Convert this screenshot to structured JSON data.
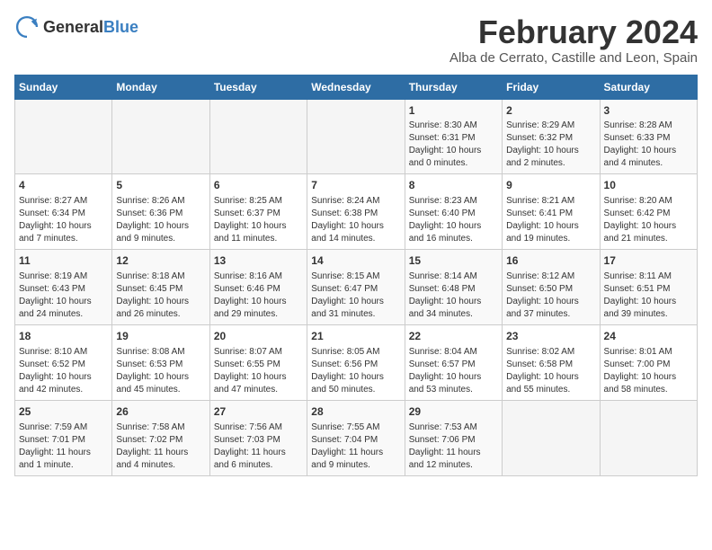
{
  "logo": {
    "general": "General",
    "blue": "Blue"
  },
  "title": "February 2024",
  "subtitle": "Alba de Cerrato, Castille and Leon, Spain",
  "days_of_week": [
    "Sunday",
    "Monday",
    "Tuesday",
    "Wednesday",
    "Thursday",
    "Friday",
    "Saturday"
  ],
  "weeks": [
    [
      {
        "day": "",
        "info": ""
      },
      {
        "day": "",
        "info": ""
      },
      {
        "day": "",
        "info": ""
      },
      {
        "day": "",
        "info": ""
      },
      {
        "day": "1",
        "info": "Sunrise: 8:30 AM\nSunset: 6:31 PM\nDaylight: 10 hours\nand 0 minutes."
      },
      {
        "day": "2",
        "info": "Sunrise: 8:29 AM\nSunset: 6:32 PM\nDaylight: 10 hours\nand 2 minutes."
      },
      {
        "day": "3",
        "info": "Sunrise: 8:28 AM\nSunset: 6:33 PM\nDaylight: 10 hours\nand 4 minutes."
      }
    ],
    [
      {
        "day": "4",
        "info": "Sunrise: 8:27 AM\nSunset: 6:34 PM\nDaylight: 10 hours\nand 7 minutes."
      },
      {
        "day": "5",
        "info": "Sunrise: 8:26 AM\nSunset: 6:36 PM\nDaylight: 10 hours\nand 9 minutes."
      },
      {
        "day": "6",
        "info": "Sunrise: 8:25 AM\nSunset: 6:37 PM\nDaylight: 10 hours\nand 11 minutes."
      },
      {
        "day": "7",
        "info": "Sunrise: 8:24 AM\nSunset: 6:38 PM\nDaylight: 10 hours\nand 14 minutes."
      },
      {
        "day": "8",
        "info": "Sunrise: 8:23 AM\nSunset: 6:40 PM\nDaylight: 10 hours\nand 16 minutes."
      },
      {
        "day": "9",
        "info": "Sunrise: 8:21 AM\nSunset: 6:41 PM\nDaylight: 10 hours\nand 19 minutes."
      },
      {
        "day": "10",
        "info": "Sunrise: 8:20 AM\nSunset: 6:42 PM\nDaylight: 10 hours\nand 21 minutes."
      }
    ],
    [
      {
        "day": "11",
        "info": "Sunrise: 8:19 AM\nSunset: 6:43 PM\nDaylight: 10 hours\nand 24 minutes."
      },
      {
        "day": "12",
        "info": "Sunrise: 8:18 AM\nSunset: 6:45 PM\nDaylight: 10 hours\nand 26 minutes."
      },
      {
        "day": "13",
        "info": "Sunrise: 8:16 AM\nSunset: 6:46 PM\nDaylight: 10 hours\nand 29 minutes."
      },
      {
        "day": "14",
        "info": "Sunrise: 8:15 AM\nSunset: 6:47 PM\nDaylight: 10 hours\nand 31 minutes."
      },
      {
        "day": "15",
        "info": "Sunrise: 8:14 AM\nSunset: 6:48 PM\nDaylight: 10 hours\nand 34 minutes."
      },
      {
        "day": "16",
        "info": "Sunrise: 8:12 AM\nSunset: 6:50 PM\nDaylight: 10 hours\nand 37 minutes."
      },
      {
        "day": "17",
        "info": "Sunrise: 8:11 AM\nSunset: 6:51 PM\nDaylight: 10 hours\nand 39 minutes."
      }
    ],
    [
      {
        "day": "18",
        "info": "Sunrise: 8:10 AM\nSunset: 6:52 PM\nDaylight: 10 hours\nand 42 minutes."
      },
      {
        "day": "19",
        "info": "Sunrise: 8:08 AM\nSunset: 6:53 PM\nDaylight: 10 hours\nand 45 minutes."
      },
      {
        "day": "20",
        "info": "Sunrise: 8:07 AM\nSunset: 6:55 PM\nDaylight: 10 hours\nand 47 minutes."
      },
      {
        "day": "21",
        "info": "Sunrise: 8:05 AM\nSunset: 6:56 PM\nDaylight: 10 hours\nand 50 minutes."
      },
      {
        "day": "22",
        "info": "Sunrise: 8:04 AM\nSunset: 6:57 PM\nDaylight: 10 hours\nand 53 minutes."
      },
      {
        "day": "23",
        "info": "Sunrise: 8:02 AM\nSunset: 6:58 PM\nDaylight: 10 hours\nand 55 minutes."
      },
      {
        "day": "24",
        "info": "Sunrise: 8:01 AM\nSunset: 7:00 PM\nDaylight: 10 hours\nand 58 minutes."
      }
    ],
    [
      {
        "day": "25",
        "info": "Sunrise: 7:59 AM\nSunset: 7:01 PM\nDaylight: 11 hours\nand 1 minute."
      },
      {
        "day": "26",
        "info": "Sunrise: 7:58 AM\nSunset: 7:02 PM\nDaylight: 11 hours\nand 4 minutes."
      },
      {
        "day": "27",
        "info": "Sunrise: 7:56 AM\nSunset: 7:03 PM\nDaylight: 11 hours\nand 6 minutes."
      },
      {
        "day": "28",
        "info": "Sunrise: 7:55 AM\nSunset: 7:04 PM\nDaylight: 11 hours\nand 9 minutes."
      },
      {
        "day": "29",
        "info": "Sunrise: 7:53 AM\nSunset: 7:06 PM\nDaylight: 11 hours\nand 12 minutes."
      },
      {
        "day": "",
        "info": ""
      },
      {
        "day": "",
        "info": ""
      }
    ]
  ]
}
